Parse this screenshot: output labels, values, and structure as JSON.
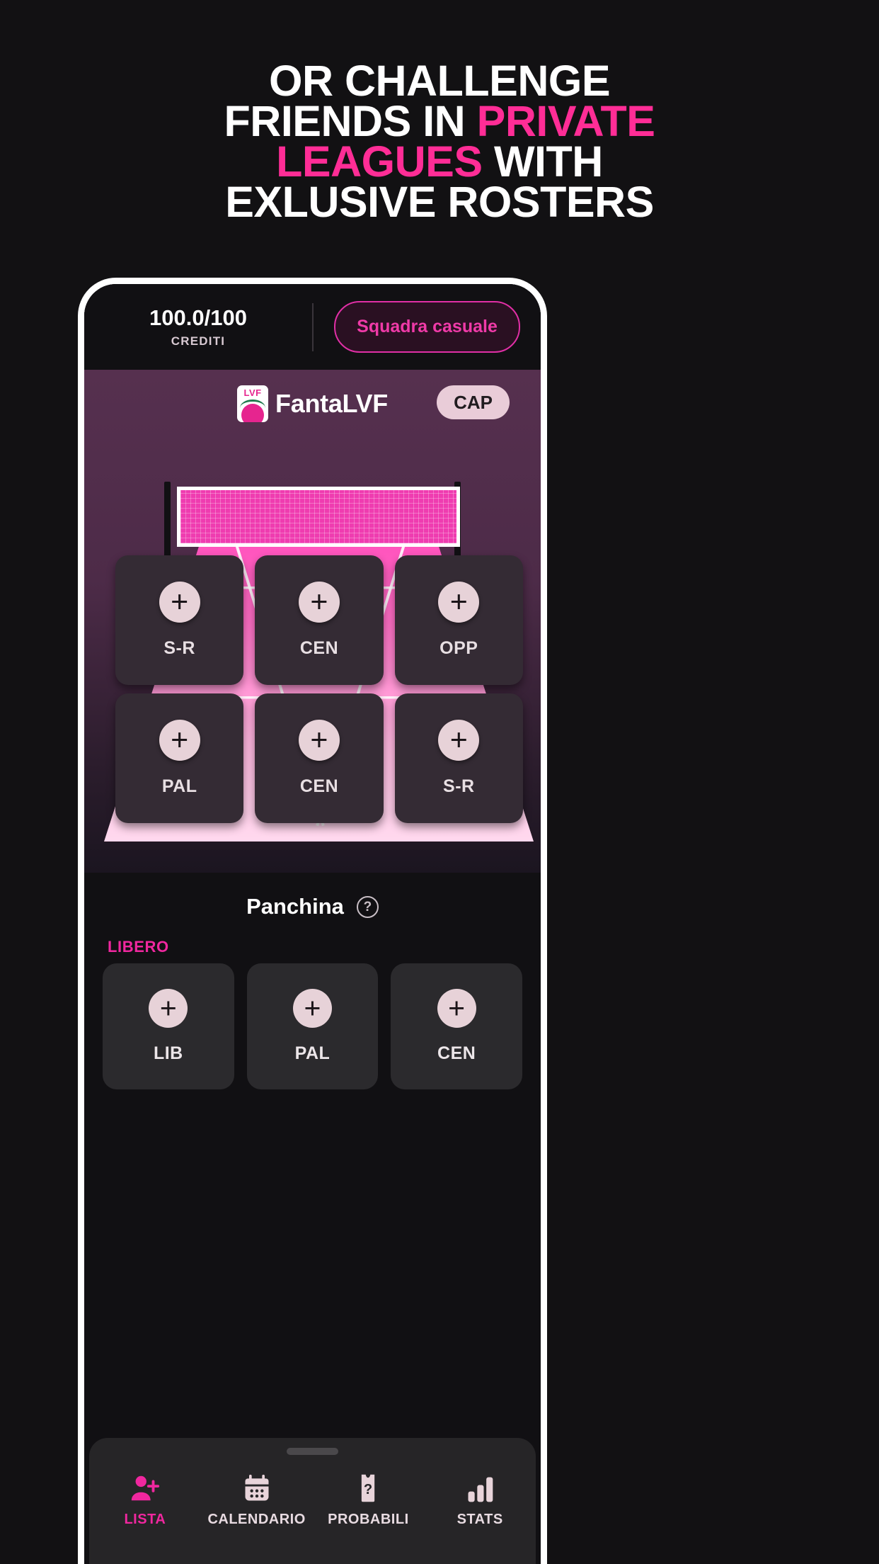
{
  "headline": {
    "line1": "OR CHALLENGE",
    "line2_white": "FRIENDS IN ",
    "line2_pink": "PRIVATE",
    "line3_pink": "LEAGUES",
    "line3_white": " WITH",
    "line4": "EXLUSIVE ROSTERS"
  },
  "colors": {
    "accent_pink": "#ff2d96",
    "bright_pink": "#ef3aa8",
    "court_pink": "#ff3fb6",
    "badge_pink": "#e9ccd8",
    "background": "#121113",
    "card_dark": "#342b34"
  },
  "app": {
    "credits": {
      "value": "100.0/100",
      "label": "CREDITI"
    },
    "random_team_button": "Squadra casuale",
    "brand": {
      "name": "FantaLVF",
      "logo_text": "LVF"
    },
    "captain_badge": "CAP",
    "court_slots": [
      {
        "label": "S-R",
        "action": "+"
      },
      {
        "label": "CEN",
        "action": "+"
      },
      {
        "label": "OPP",
        "action": "+"
      },
      {
        "label": "PAL",
        "action": "+"
      },
      {
        "label": "CEN",
        "action": "+"
      },
      {
        "label": "S-R",
        "action": "+"
      }
    ],
    "bench": {
      "title": "Panchina",
      "help": "?",
      "libero_label": "LIBERO",
      "slots": [
        {
          "label": "LIB",
          "action": "+"
        },
        {
          "label": "PAL",
          "action": "+"
        },
        {
          "label": "CEN",
          "action": "+"
        }
      ]
    },
    "nav": [
      {
        "label": "LISTA",
        "icon": "person-add-icon",
        "active": true
      },
      {
        "label": "CALENDARIO",
        "icon": "calendar-icon",
        "active": false
      },
      {
        "label": "PROBABILI",
        "icon": "jersey-question-icon",
        "active": false
      },
      {
        "label": "STATS",
        "icon": "bar-chart-icon",
        "active": false
      }
    ]
  }
}
